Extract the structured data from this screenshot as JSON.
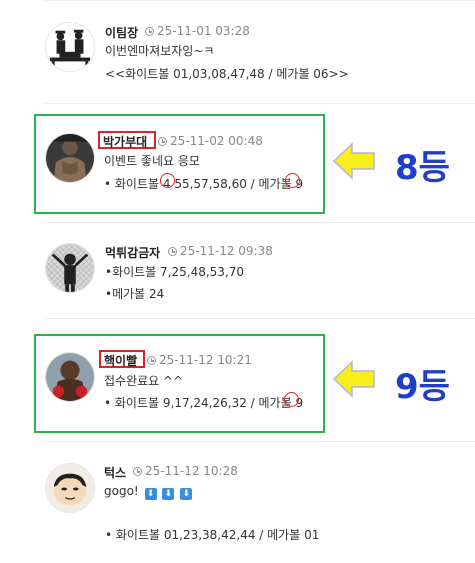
{
  "comments": [
    {
      "name": "이팀장",
      "time": "25-11-01 03:28",
      "line1": "이번엔마져보자잉~ㅋ",
      "line2": "<<화이트볼 01,03,08,47,48 / 메가볼 06>>"
    },
    {
      "name": "박가부대",
      "time": "25-11-02 00:48",
      "line1": "이벤트 좋네요 응모",
      "line2_prefix": "• 화이트볼 ",
      "line2_circled": "4",
      "line2_rest": " 55,57,58,60 / 메가볼 ",
      "line2_mega": "9",
      "rank": "8등"
    },
    {
      "name": "먹튀감금자",
      "time": "25-11-12 09:38",
      "line1": "•화이트볼 7,25,48,53,70",
      "line2": "•메가볼 24"
    },
    {
      "name": "핵이빨",
      "time": "25-11-12 10:21",
      "line1": "접수완료요 ^^",
      "line2_prefix": "• 화이트볼 9,17,24,26,32 / 메가볼 ",
      "line2_mega": "9",
      "rank": "9등"
    },
    {
      "name": "턱스",
      "time": "25-11-12 10:28",
      "line1": "gogo!",
      "line1_emoji": [
        "⬇",
        "⬇",
        "⬇"
      ],
      "line2": "• 화이트볼 01,23,38,42,44 / 메가볼 01"
    }
  ],
  "colors": {
    "highlight_box": "#2db34a",
    "mark": "#e0202a",
    "rank_text": "#1f3fc9",
    "arrow": "#f7ef1b"
  },
  "icons": [
    "clock-icon",
    "arrow-right-icon",
    "down-arrow-emoji"
  ]
}
